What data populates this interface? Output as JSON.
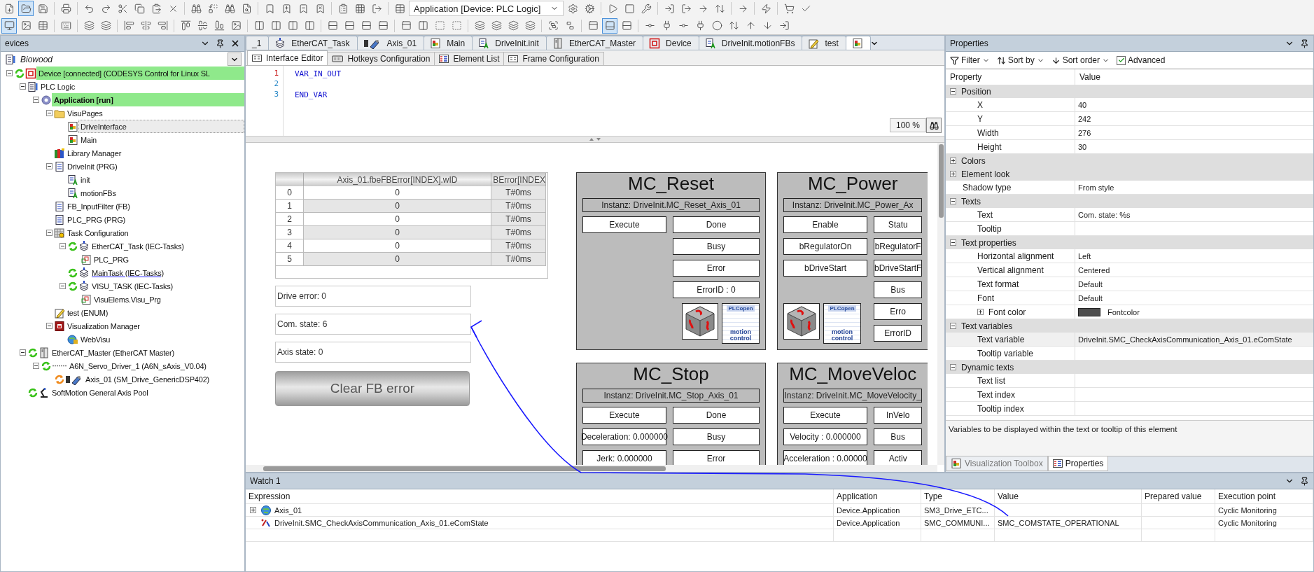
{
  "toolbar": {
    "application_selector": "Application [Device: PLC Logic]"
  },
  "devices": {
    "title": "evices",
    "project": "Biowood",
    "tree": [
      {
        "label": "Device [connected] (CODESYS Control for Linux SL",
        "kind": "device",
        "color": "#3ac21a",
        "highlighted": true,
        "selected": false,
        "hovered": false,
        "children": [
          {
            "label": "PLC Logic",
            "kind": "plc",
            "highlighted": false,
            "selected": false,
            "hovered": false,
            "children": [
              {
                "label": "Application [run]",
                "kind": "application",
                "highlighted": true,
                "selected": false,
                "hovered": false,
                "children": [
                  {
                    "label": "VisuPages",
                    "kind": "folder",
                    "highlighted": false,
                    "selected": false,
                    "hovered": false,
                    "children": [
                      {
                        "label": "DriveInterface",
                        "kind": "visu",
                        "highlighted": false,
                        "selected": true,
                        "hovered": false
                      },
                      {
                        "label": "Main",
                        "kind": "visu",
                        "highlighted": false,
                        "selected": false,
                        "hovered": false
                      }
                    ]
                  },
                  {
                    "label": "Library Manager",
                    "kind": "library",
                    "highlighted": false,
                    "selected": false,
                    "hovered": false
                  },
                  {
                    "label": "DriveInit (PRG)",
                    "kind": "pou",
                    "highlighted": false,
                    "selected": false,
                    "hovered": false,
                    "children": [
                      {
                        "label": "init",
                        "kind": "action",
                        "highlighted": false,
                        "selected": false,
                        "hovered": false
                      },
                      {
                        "label": "motionFBs",
                        "kind": "action",
                        "highlighted": false,
                        "selected": false,
                        "hovered": false
                      }
                    ]
                  },
                  {
                    "label": "FB_InputFilter (FB)",
                    "kind": "pou",
                    "highlighted": false,
                    "selected": false,
                    "hovered": false
                  },
                  {
                    "label": "PLC_PRG (PRG)",
                    "kind": "pou",
                    "highlighted": false,
                    "selected": false,
                    "hovered": false
                  },
                  {
                    "label": "Task Configuration",
                    "kind": "taskconfig",
                    "highlighted": false,
                    "selected": false,
                    "hovered": false,
                    "children": [
                      {
                        "label": "EtherCAT_Task (IEC-Tasks)",
                        "kind": "task",
                        "color": "#3ac21a",
                        "highlighted": false,
                        "selected": false,
                        "hovered": false,
                        "children": [
                          {
                            "label": "PLC_PRG",
                            "kind": "call",
                            "highlighted": false,
                            "selected": false,
                            "hovered": false
                          }
                        ]
                      },
                      {
                        "label": "MainTask (IEC-Tasks)",
                        "kind": "task",
                        "color": "#3ac21a",
                        "highlighted": false,
                        "selected": false,
                        "hovered": true
                      },
                      {
                        "label": "VISU_TASK (IEC-Tasks)",
                        "kind": "task",
                        "color": "#3ac21a",
                        "highlighted": false,
                        "selected": false,
                        "hovered": false,
                        "children": [
                          {
                            "label": "VisuElems.Visu_Prg",
                            "kind": "call",
                            "highlighted": false,
                            "selected": false,
                            "hovered": false
                          }
                        ]
                      }
                    ]
                  },
                  {
                    "label": "test (ENUM)",
                    "kind": "enum",
                    "highlighted": false,
                    "selected": false,
                    "hovered": false
                  },
                  {
                    "label": "Visualization Manager",
                    "kind": "visumanager",
                    "highlighted": false,
                    "selected": false,
                    "hovered": false,
                    "children": [
                      {
                        "label": "WebVisu",
                        "kind": "webvisu",
                        "highlighted": false,
                        "selected": false,
                        "hovered": false
                      }
                    ]
                  }
                ]
              }
            ]
          },
          {
            "label": "EtherCAT_Master (EtherCAT Master)",
            "kind": "ethercat",
            "color": "#3ac21a",
            "highlighted": false,
            "selected": false,
            "hovered": false,
            "children": [
              {
                "label": "A6N_Servo_Driver_1 (A6N_sAxis_V0.04)",
                "kind": "servo",
                "color": "#3ac21a",
                "highlighted": false,
                "selected": false,
                "hovered": false,
                "children": [
                  {
                    "label": "Axis_01 (SM_Drive_GenericDSP402)",
                    "kind": "axis",
                    "color": "#f08a1c",
                    "highlighted": false,
                    "selected": false,
                    "hovered": false
                  }
                ]
              }
            ]
          },
          {
            "label": "SoftMotion General Axis Pool",
            "kind": "pool",
            "color": "#3ac21a",
            "highlighted": false,
            "selected": false,
            "hovered": false
          }
        ]
      }
    ]
  },
  "editor": {
    "tabs": [
      {
        "label": "_1",
        "selected": false
      },
      {
        "label": "EtherCAT_Task",
        "kind": "task",
        "selected": false
      },
      {
        "label": "Axis_01",
        "kind": "axis",
        "selected": false
      },
      {
        "label": "Main",
        "kind": "visu",
        "selected": false
      },
      {
        "label": "DriveInit.init",
        "kind": "action",
        "selected": false
      },
      {
        "label": "EtherCAT_Master",
        "kind": "ethercat",
        "selected": false
      },
      {
        "label": "Device",
        "kind": "device",
        "selected": false
      },
      {
        "label": "DriveInit.motionFBs",
        "kind": "action",
        "selected": false
      },
      {
        "label": "test",
        "kind": "enum",
        "selected": false
      },
      {
        "kind": "visu",
        "selected": true
      }
    ],
    "subtabs": [
      {
        "label": "Interface Editor",
        "kind": "form",
        "selected": true
      },
      {
        "label": "Hotkeys Configuration",
        "kind": "keyboard",
        "selected": false
      },
      {
        "label": "Element List",
        "kind": "list",
        "selected": false
      },
      {
        "label": "Frame Configuration",
        "kind": "form",
        "selected": false
      }
    ],
    "code": [
      {
        "number": "1",
        "text": "VAR_IN_OUT",
        "current": true
      },
      {
        "number": "2",
        "current": false
      },
      {
        "number": "3",
        "text": "END_VAR",
        "current": false
      }
    ],
    "zoom": "100 %",
    "canvas": {
      "table": {
        "columns": [
          "Axis_01.fbeFBError[INDEX].wID",
          "BError[INDEX"
        ],
        "rows": [
          {
            "index": "0",
            "cells": [
              "0",
              "T#0ms"
            ]
          },
          {
            "index": "1",
            "cells": [
              "0",
              "T#0ms"
            ]
          },
          {
            "index": "2",
            "cells": [
              "0",
              "T#0ms"
            ]
          },
          {
            "index": "3",
            "cells": [
              "0",
              "T#0ms"
            ]
          },
          {
            "index": "4",
            "cells": [
              "0",
              "T#0ms"
            ]
          },
          {
            "index": "5",
            "cells": [
              "0",
              "T#0ms"
            ]
          }
        ]
      },
      "fields": [
        "Drive error: 0",
        "Com. state: 6",
        "Axis state: 0"
      ],
      "button": "Clear FB error",
      "blocks": [
        {
          "title": "MC_Reset",
          "instance": "Instanz: DriveInit.MC_Reset_Axis_01",
          "inputs": [
            "Execute"
          ],
          "outputs": [
            "Done",
            "Busy",
            "Error",
            "ErrorID : 0"
          ],
          "logo": {
            "top": "PLCopen",
            "bottom": "motion control"
          }
        },
        {
          "title": "MC_Power",
          "instance": "Instanz: DriveInit.MC_Power_Ax",
          "inputs": [
            "Enable",
            "bRegulatorOn",
            "bDriveStart"
          ],
          "outputs": [
            "Statu",
            "bRegulatorF",
            "bDriveStartF",
            "Bus",
            "Erro",
            "ErrorID"
          ],
          "logo": {
            "top": "PLCopen",
            "bottom": "motion control"
          }
        },
        {
          "title": "MC_Stop",
          "instance": "Instanz: DriveInit.MC_Stop_Axis_01",
          "inputs": [
            "Execute",
            "Deceleration: 0.000000",
            "Jerk: 0.000000"
          ],
          "outputs": [
            "Done",
            "Busy",
            "Error"
          ]
        },
        {
          "title": "MC_MoveVeloc",
          "instance": "Instanz: DriveInit.MC_MoveVelocity_",
          "inputs": [
            "Execute",
            "Velocity : 0.000000",
            "Acceleration : 0.00000"
          ],
          "outputs": [
            "InVelo",
            "Bus",
            "Activ"
          ]
        }
      ]
    }
  },
  "properties": {
    "title": "Properties",
    "toolbar": {
      "filter": "Filter",
      "sort_by": "Sort by",
      "sort_order": "Sort order",
      "advanced": {
        "label": "Advanced",
        "checked": true
      }
    },
    "columns": [
      "Property",
      "Value"
    ],
    "rows": [
      {
        "kind": "category",
        "label": "Position",
        "expanded": true,
        "children": [
          {
            "kind": "property",
            "label": "X",
            "value": "40",
            "selected": false
          },
          {
            "kind": "property",
            "label": "Y",
            "value": "242",
            "selected": false
          },
          {
            "kind": "property",
            "label": "Width",
            "value": "276",
            "selected": false
          },
          {
            "kind": "property",
            "label": "Height",
            "value": "30",
            "selected": false
          }
        ]
      },
      {
        "kind": "category",
        "label": "Colors",
        "expanded": false
      },
      {
        "kind": "category",
        "label": "Element look",
        "expanded": false
      },
      {
        "kind": "property",
        "label": "Shadow type",
        "value": "From style",
        "selected": false
      },
      {
        "kind": "category",
        "label": "Texts",
        "expanded": true,
        "children": [
          {
            "kind": "property",
            "label": "Text",
            "value": "Com. state: %s",
            "selected": false
          },
          {
            "kind": "property",
            "label": "Tooltip",
            "selected": false
          }
        ]
      },
      {
        "kind": "category",
        "label": "Text properties",
        "expanded": true,
        "children": [
          {
            "kind": "property",
            "label": "Horizontal alignment",
            "value": "Left",
            "selected": false
          },
          {
            "kind": "property",
            "label": "Vertical alignment",
            "value": "Centered",
            "selected": false
          },
          {
            "kind": "property",
            "label": "Text format",
            "value": "Default",
            "selected": false
          },
          {
            "kind": "property",
            "label": "Font",
            "value": "Default",
            "selected": false
          },
          {
            "kind": "color",
            "label": "Font color",
            "value": "Fontcolor",
            "color": "#4d4d4d",
            "expanded": false,
            "selected": false
          }
        ]
      },
      {
        "kind": "category",
        "label": "Text variables",
        "expanded": true,
        "children": [
          {
            "kind": "property",
            "label": "Text variable",
            "value": "DriveInit.SMC_CheckAxisCommunication_Axis_01.eComState",
            "selected": true
          },
          {
            "kind": "property",
            "label": "Tooltip variable",
            "selected": false
          }
        ]
      },
      {
        "kind": "category",
        "label": "Dynamic texts",
        "expanded": true,
        "children": [
          {
            "kind": "property",
            "label": "Text list",
            "selected": false
          },
          {
            "kind": "property",
            "label": "Text index",
            "selected": false
          },
          {
            "kind": "property",
            "label": "Tooltip index",
            "selected": false
          }
        ]
      }
    ],
    "description": "Variables to be displayed within the text or tooltip of this element",
    "tabs": [
      {
        "label": "Visualization Toolbox",
        "selected": false
      },
      {
        "label": "Properties",
        "selected": true
      }
    ]
  },
  "watch": {
    "title": "Watch 1",
    "columns": [
      "Expression",
      "Application",
      "Type",
      "Value",
      "Prepared value",
      "Execution point"
    ],
    "rows": [
      {
        "kind": "globe",
        "expanded": false,
        "cells": [
          "Axis_01",
          "Device.Application",
          "SM3_Drive_ETC...",
          null,
          null,
          "Cyclic Monitoring"
        ]
      },
      {
        "kind": "variable",
        "cells": [
          "DriveInit.SMC_CheckAxisCommunication_Axis_01.eComState",
          "Device.Application",
          "SMC_COMMUNI...",
          "SMC_COMSTATE_OPERATIONAL",
          null,
          "Cyclic Monitoring"
        ]
      }
    ]
  }
}
